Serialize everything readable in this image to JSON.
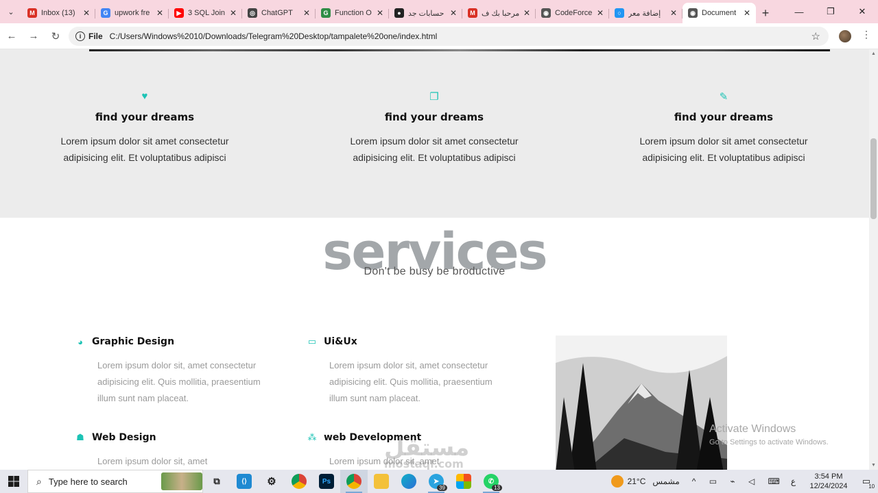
{
  "browser": {
    "tabs": [
      {
        "label": "Inbox (13)",
        "color": "#d93025",
        "glyph": "M"
      },
      {
        "label": "upwork fre",
        "color": "#4285f4",
        "glyph": "G"
      },
      {
        "label": "3 SQL Join",
        "color": "#ff0000",
        "glyph": "▶"
      },
      {
        "label": "ChatGPT",
        "color": "#444444",
        "glyph": "◎"
      },
      {
        "label": "Function O",
        "color": "#2f8d46",
        "glyph": "G"
      },
      {
        "label": "حسابات جد",
        "color": "#222222",
        "glyph": "●"
      },
      {
        "label": "مرحبا بك ف",
        "color": "#d93025",
        "glyph": "M"
      },
      {
        "label": "CodeForce",
        "color": "#555555",
        "glyph": "◉"
      },
      {
        "label": "إضافة معر",
        "color": "#2196f3",
        "glyph": "○"
      },
      {
        "label": "Document",
        "color": "#555555",
        "glyph": "◉",
        "active": true
      }
    ],
    "new_tab": "+",
    "address": {
      "scheme": "File",
      "url": "C:/Users/Windows%2010/Downloads/Telegram%20Desktop/tampalete%20one/index.html"
    }
  },
  "features": [
    {
      "icon": "heart-icon",
      "glyph": "♥",
      "title": "find your dreams",
      "text": "Lorem ipsum dolor sit amet consectetur adipisicing elit. Et voluptatibus adipisci"
    },
    {
      "icon": "copy-icon",
      "glyph": "❐",
      "title": "find your dreams",
      "text": "Lorem ipsum dolor sit amet consectetur adipisicing elit. Et voluptatibus adipisci"
    },
    {
      "icon": "pencil-icon",
      "glyph": "✎",
      "title": "find your dreams",
      "text": "Lorem ipsum dolor sit amet consectetur adipisicing elit. Et voluptatibus adipisci"
    }
  ],
  "services": {
    "title": "services",
    "subtitle": "Don't be busy be broductive",
    "items": [
      {
        "icon": "pie-chart-icon",
        "glyph": "◕",
        "title": "Graphic Design",
        "text": "Lorem ipsum dolor sit, amet consectetur adipisicing elit. Quis mollitia, praesentium illum sunt nam placeat."
      },
      {
        "icon": "monitor-icon",
        "glyph": "▭",
        "title": "Ui&Ux",
        "text": "Lorem ipsum dolor sit, amet consectetur adipisicing elit. Quis mollitia, praesentium illum sunt nam placeat."
      },
      {
        "icon": "ghost-icon",
        "glyph": "☗",
        "title": "Web Design",
        "text": "Lorem ipsum dolor sit, amet"
      },
      {
        "icon": "cubes-icon",
        "glyph": "⁂",
        "title": "web Development",
        "text": "Lorem ipsum dolor sit, amet"
      }
    ]
  },
  "overlay": {
    "activate_title": "Activate Windows",
    "activate_sub": "Go to Settings to activate Windows.",
    "mostaql": "مستقل",
    "mostaql_sub": "mostaql.com"
  },
  "taskbar": {
    "search_placeholder": "Type here to search",
    "weather_temp": "21°C",
    "weather_text": "مشمس",
    "lang": "ع",
    "time": "3:54 PM",
    "date": "12/24/2024",
    "notifications": "10",
    "telegram_badge": "39",
    "whatsapp_badge": "13"
  },
  "colors": {
    "accent": "#1dc3b5",
    "tabstrip": "#f8d7e0"
  }
}
